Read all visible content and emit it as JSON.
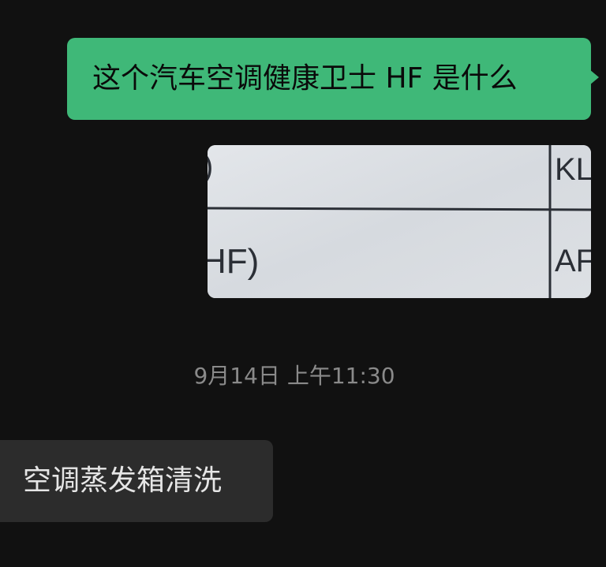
{
  "messages": {
    "outgoing_text": "这个汽车空调健康卫士 HF 是什么",
    "photo": {
      "fragment_left_top": ")",
      "fragment_left_bottom": "HF)",
      "fragment_right_top": "KL",
      "fragment_right_bottom": "AF"
    },
    "timestamp": "9月14日 上午11:30",
    "incoming_text": "空调蒸发箱清洗"
  },
  "colors": {
    "background": "#111111",
    "outgoing_bubble": "#3fb878",
    "incoming_bubble": "#2c2c2c",
    "timestamp_text": "#8a8a8a"
  }
}
